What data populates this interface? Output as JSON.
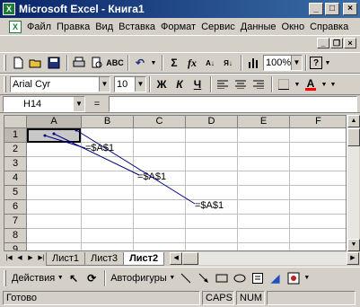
{
  "window": {
    "title": "Microsoft Excel - Книга1",
    "app_icon": "excel-icon"
  },
  "menu": {
    "items": [
      "Файл",
      "Правка",
      "Вид",
      "Вставка",
      "Формат",
      "Сервис",
      "Данные",
      "Окно",
      "Справка"
    ]
  },
  "toolbar": {
    "zoom": "100%",
    "help": "?",
    "sigma": "Σ",
    "fx": "fx"
  },
  "format_toolbar": {
    "font": "Arial Cyr",
    "size": "10",
    "bold": "Ж",
    "italic": "К",
    "underline": "Ч",
    "font_color_label": "A"
  },
  "formula_bar": {
    "name_box": "H14",
    "equals": "=",
    "value": ""
  },
  "sheet": {
    "columns": [
      "A",
      "B",
      "C",
      "D",
      "E",
      "F"
    ],
    "rows": [
      "1",
      "2",
      "3",
      "4",
      "5",
      "6",
      "7",
      "8",
      "9"
    ],
    "cells": [
      {
        "ref": "B2",
        "value": "=$A$1"
      },
      {
        "ref": "C4",
        "value": "=$A$1"
      },
      {
        "ref": "E6",
        "value": "=$A$1"
      }
    ]
  },
  "tabs": {
    "items": [
      "Лист1",
      "Лист3",
      "Лист2"
    ],
    "active": "Лист2"
  },
  "drawing": {
    "actions": "Действия",
    "autoshapes": "Автофигуры"
  },
  "status": {
    "ready": "Готово",
    "caps": "CAPS",
    "num": "NUM"
  }
}
